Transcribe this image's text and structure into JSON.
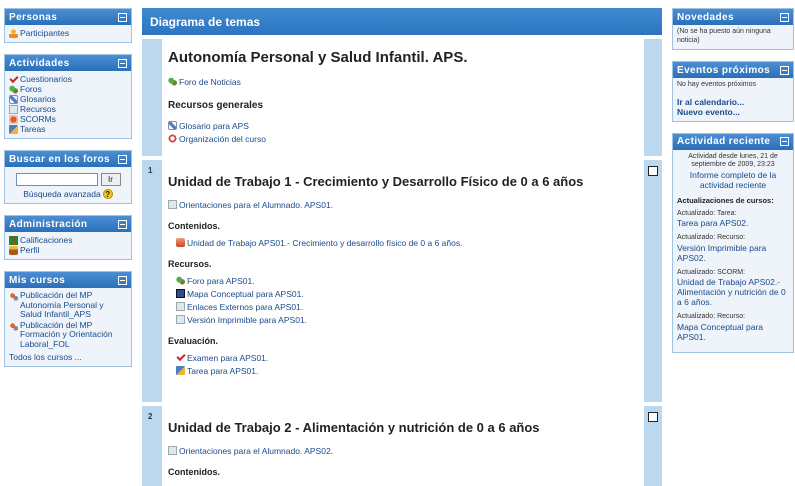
{
  "left": {
    "personas": {
      "title": "Personas",
      "items": [
        "Participantes"
      ]
    },
    "actividades": {
      "title": "Actividades",
      "items": [
        "Cuestionarios",
        "Foros",
        "Glosarios",
        "Recursos",
        "SCORMs",
        "Tareas"
      ]
    },
    "buscar": {
      "title": "Buscar en los foros",
      "button": "Ir",
      "advanced": "Búsqueda avanzada",
      "help": "?"
    },
    "administracion": {
      "title": "Administración",
      "items": [
        "Calificaciones",
        "Perfil"
      ]
    },
    "mis_cursos": {
      "title": "Mis cursos",
      "courses": [
        "Publicación del MP\n   Autonomía Personal y\nSalud Infantil_APS",
        "Publicación del MP\n   Formación y Orientación\nLaboral_FOL"
      ],
      "all": "Todos los cursos ..."
    }
  },
  "main": {
    "header": "Diagrama de temas",
    "section0": {
      "title": "Autonomía Personal y Salud Infantil. APS.",
      "news": "Foro de Noticias",
      "general_heading": "Recursos generales",
      "items": [
        "Glosario para APS",
        "Organización del curso"
      ]
    },
    "section1": {
      "number": "1",
      "title": "Unidad de Trabajo 1 - Crecimiento y Desarrollo Físico de 0 a 6 años",
      "intro": "Orientaciones para el Alumnado. APS01.",
      "contenidos": "Contenidos.",
      "contenido_items": [
        "Unidad de Trabajo APS01.- Crecimiento y desarrollo físico de 0 a 6 años."
      ],
      "recursos": "Recursos.",
      "recurso_items": [
        "Foro para APS01.",
        "Mapa Conceptual para APS01.",
        "Enlaces Externos para APS01.",
        "Versión Imprimible para APS01."
      ],
      "evaluacion": "Evaluación.",
      "evaluacion_items": [
        "Examen para APS01.",
        "Tarea para APS01."
      ]
    },
    "section2": {
      "number": "2",
      "title": "Unidad de Trabajo 2 - Alimentación y nutrición de 0 a 6 años",
      "intro": "Orientaciones para el Alumnado. APS02.",
      "contenidos": "Contenidos."
    }
  },
  "right": {
    "novedades": {
      "title": "Novedades",
      "text": "(No se ha puesto aún ninguna noticia)"
    },
    "eventos": {
      "title": "Eventos próximos",
      "none": "No hay eventos próximos",
      "calendar": "Ir al calendario...",
      "new": "Nuevo evento..."
    },
    "reciente": {
      "title": "Actividad reciente",
      "since": "Actividad desde lunes, 21 de septiembre de 2009, 23:23",
      "report": "Informe completo de la actividad reciente",
      "updates_heading": "Actualizaciones de cursos:",
      "entries": [
        {
          "label": "Actualizado: Tarea:",
          "link": "Tarea para APS02."
        },
        {
          "label": "Actualizado: Recurso:",
          "link": "Versión Imprimible para APS02."
        },
        {
          "label": "Actualizado: SCORM:",
          "link": "Unidad de Trabajo APS02.- Alimentación y nutrición de 0 a 6 años."
        },
        {
          "label": "Actualizado: Recurso:",
          "link": "Mapa Conceptual para APS01."
        }
      ]
    }
  }
}
